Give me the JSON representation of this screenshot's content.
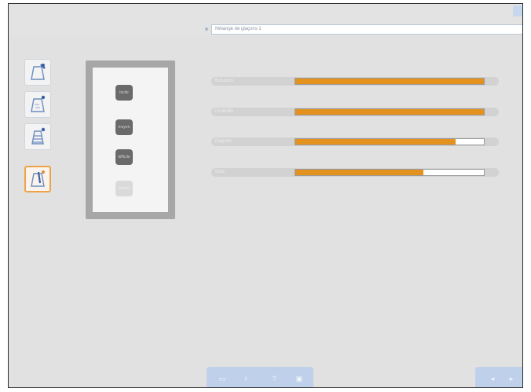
{
  "app": {
    "title": "",
    "address": "Mélange de glaçons 1"
  },
  "sidebar": {
    "items": [
      {
        "name": "level-a",
        "icon": "cup-pencil-icon",
        "active": false
      },
      {
        "name": "level-b",
        "icon": "cup-pencil-icon",
        "active": false
      },
      {
        "name": "level-c",
        "icon": "cup-lines-icon",
        "active": false
      },
      {
        "name": "level-d",
        "icon": "cup-pencil-icon",
        "active": true
      }
    ]
  },
  "levels": {
    "buttons": [
      {
        "label": "facile",
        "enabled": true
      },
      {
        "label": "moyen",
        "enabled": true
      },
      {
        "label": "difficile",
        "enabled": true
      },
      {
        "label": "expert",
        "enabled": false
      }
    ]
  },
  "progress": {
    "rows": [
      {
        "label": "Boissons",
        "value": 1.0
      },
      {
        "label": "Cocktails",
        "value": 1.0
      },
      {
        "label": "Glaçons",
        "value": 0.85
      },
      {
        "label": "Total",
        "value": 0.68
      }
    ]
  },
  "colors": {
    "accent": "#e4921e",
    "panel": "#a7a7a7",
    "toolbar": "#bfd0ea"
  },
  "toolbar": {
    "buttons": [
      {
        "name": "save",
        "icon": "save-icon",
        "glyph": "▭"
      },
      {
        "name": "info",
        "icon": "info-icon",
        "glyph": "i"
      },
      {
        "name": "help",
        "icon": "help-icon",
        "glyph": "?"
      },
      {
        "name": "print",
        "icon": "print-icon",
        "glyph": "▣"
      }
    ]
  },
  "nav": {
    "prev": "◂",
    "next": "▸"
  }
}
